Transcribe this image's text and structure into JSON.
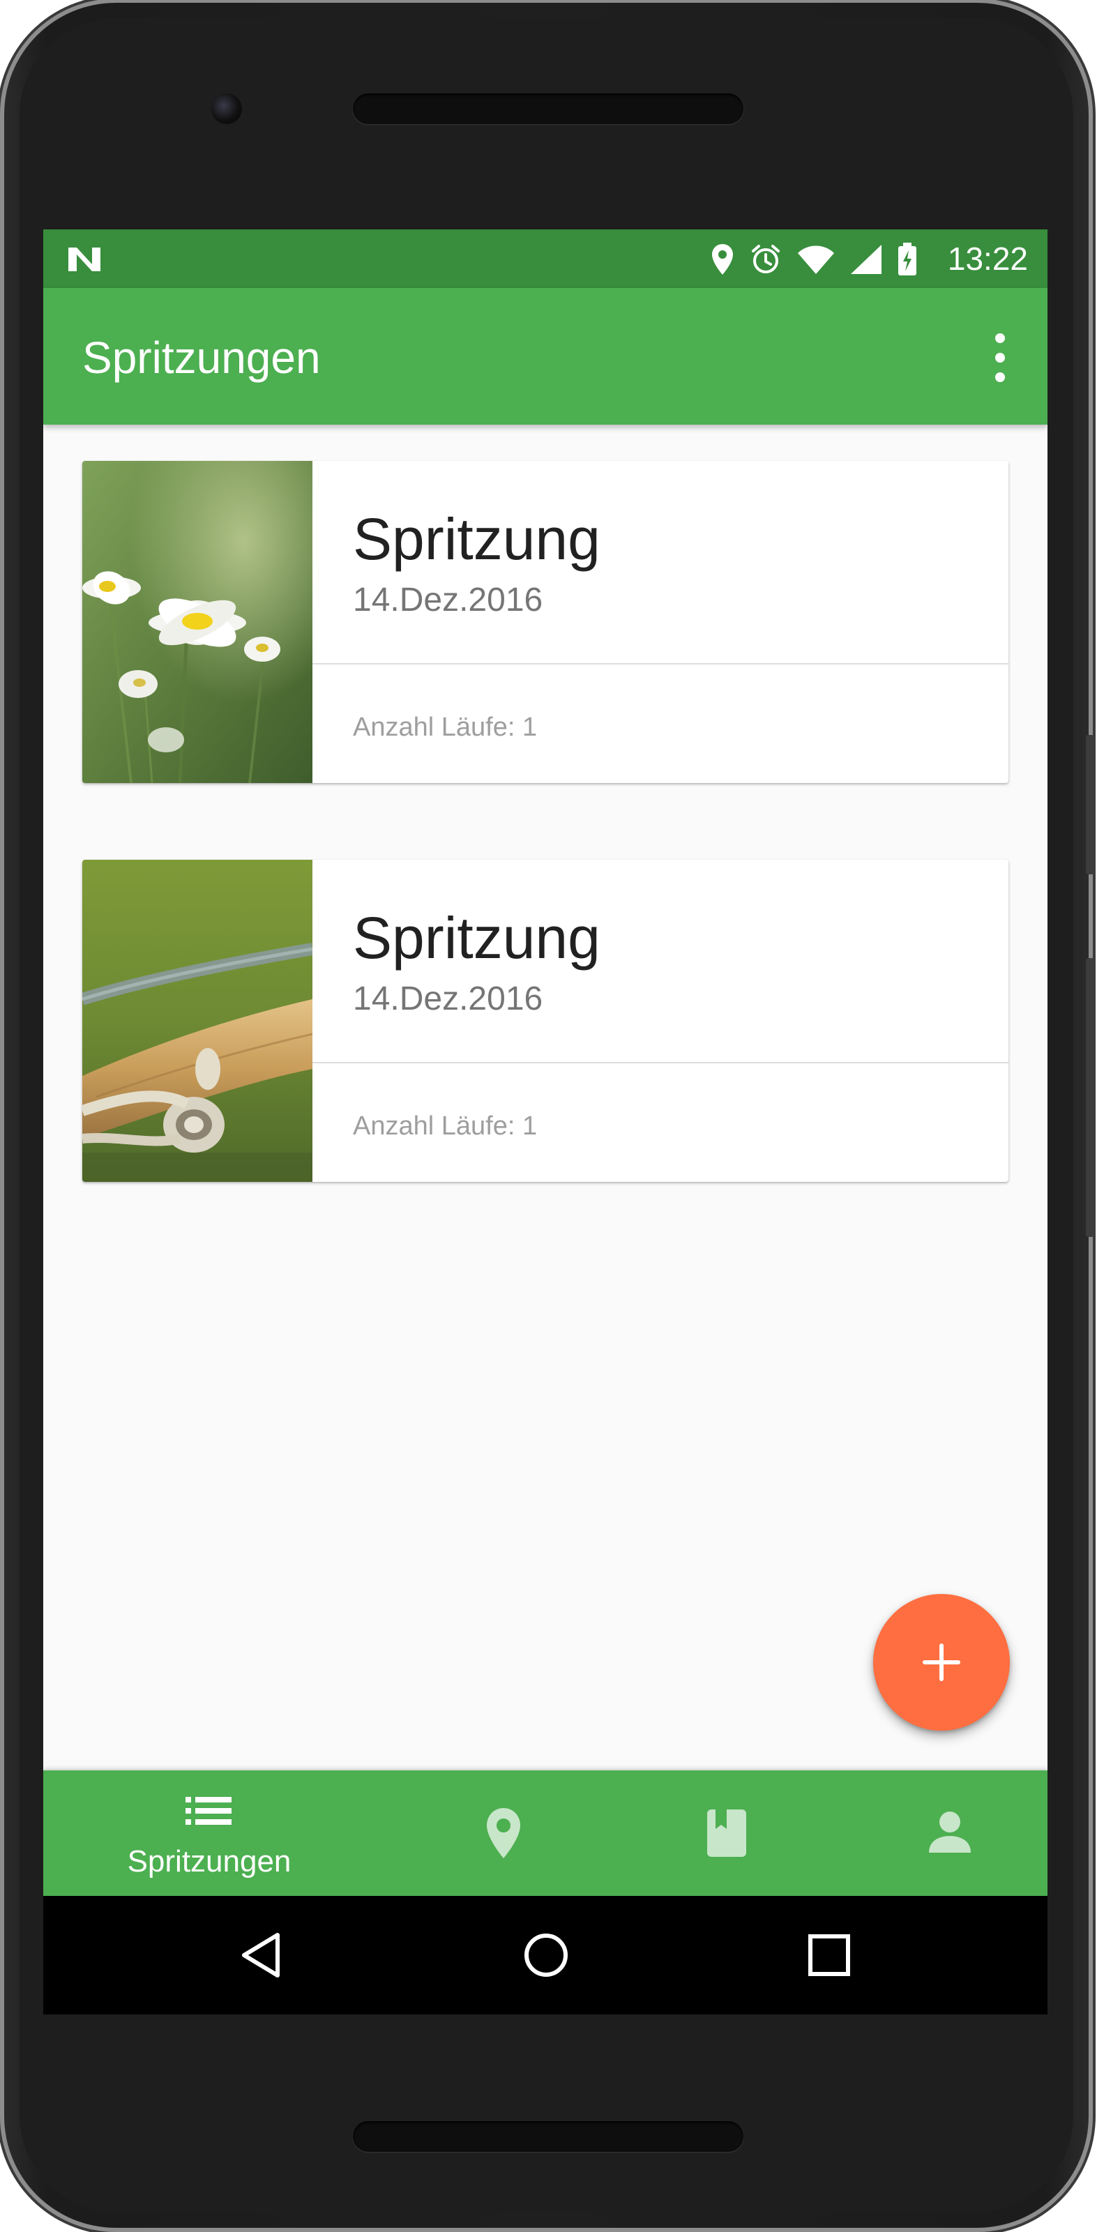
{
  "status_bar": {
    "time": "13:22",
    "icons": [
      "notification-n-icon",
      "location-icon",
      "alarm-icon",
      "wifi-icon",
      "signal-icon",
      "battery-charging-icon"
    ]
  },
  "toolbar": {
    "title": "Spritzungen",
    "menu_icon": "more-vert-icon"
  },
  "cards": [
    {
      "title": "Spritzung",
      "date": "14.Dez.2016",
      "meta": "Anzahl Läufe: 1",
      "image": "daisies-photo"
    },
    {
      "title": "Spritzung",
      "date": "14.Dez.2016",
      "meta": "Anzahl Läufe: 1",
      "image": "vine-wire-photo"
    }
  ],
  "fab": {
    "icon": "add-icon"
  },
  "bottom_nav": {
    "items": [
      {
        "icon": "list-icon",
        "label": "Spritzungen",
        "active": true
      },
      {
        "icon": "location-icon",
        "active": false
      },
      {
        "icon": "book-icon",
        "active": false
      },
      {
        "icon": "person-icon",
        "active": false
      }
    ]
  },
  "system_nav": {
    "buttons": [
      "back-icon",
      "home-icon",
      "recents-icon"
    ]
  },
  "colors": {
    "primary": "#4caf50",
    "primary_dark": "#388e3c",
    "accent": "#ff6e40",
    "background": "#fafafa"
  }
}
